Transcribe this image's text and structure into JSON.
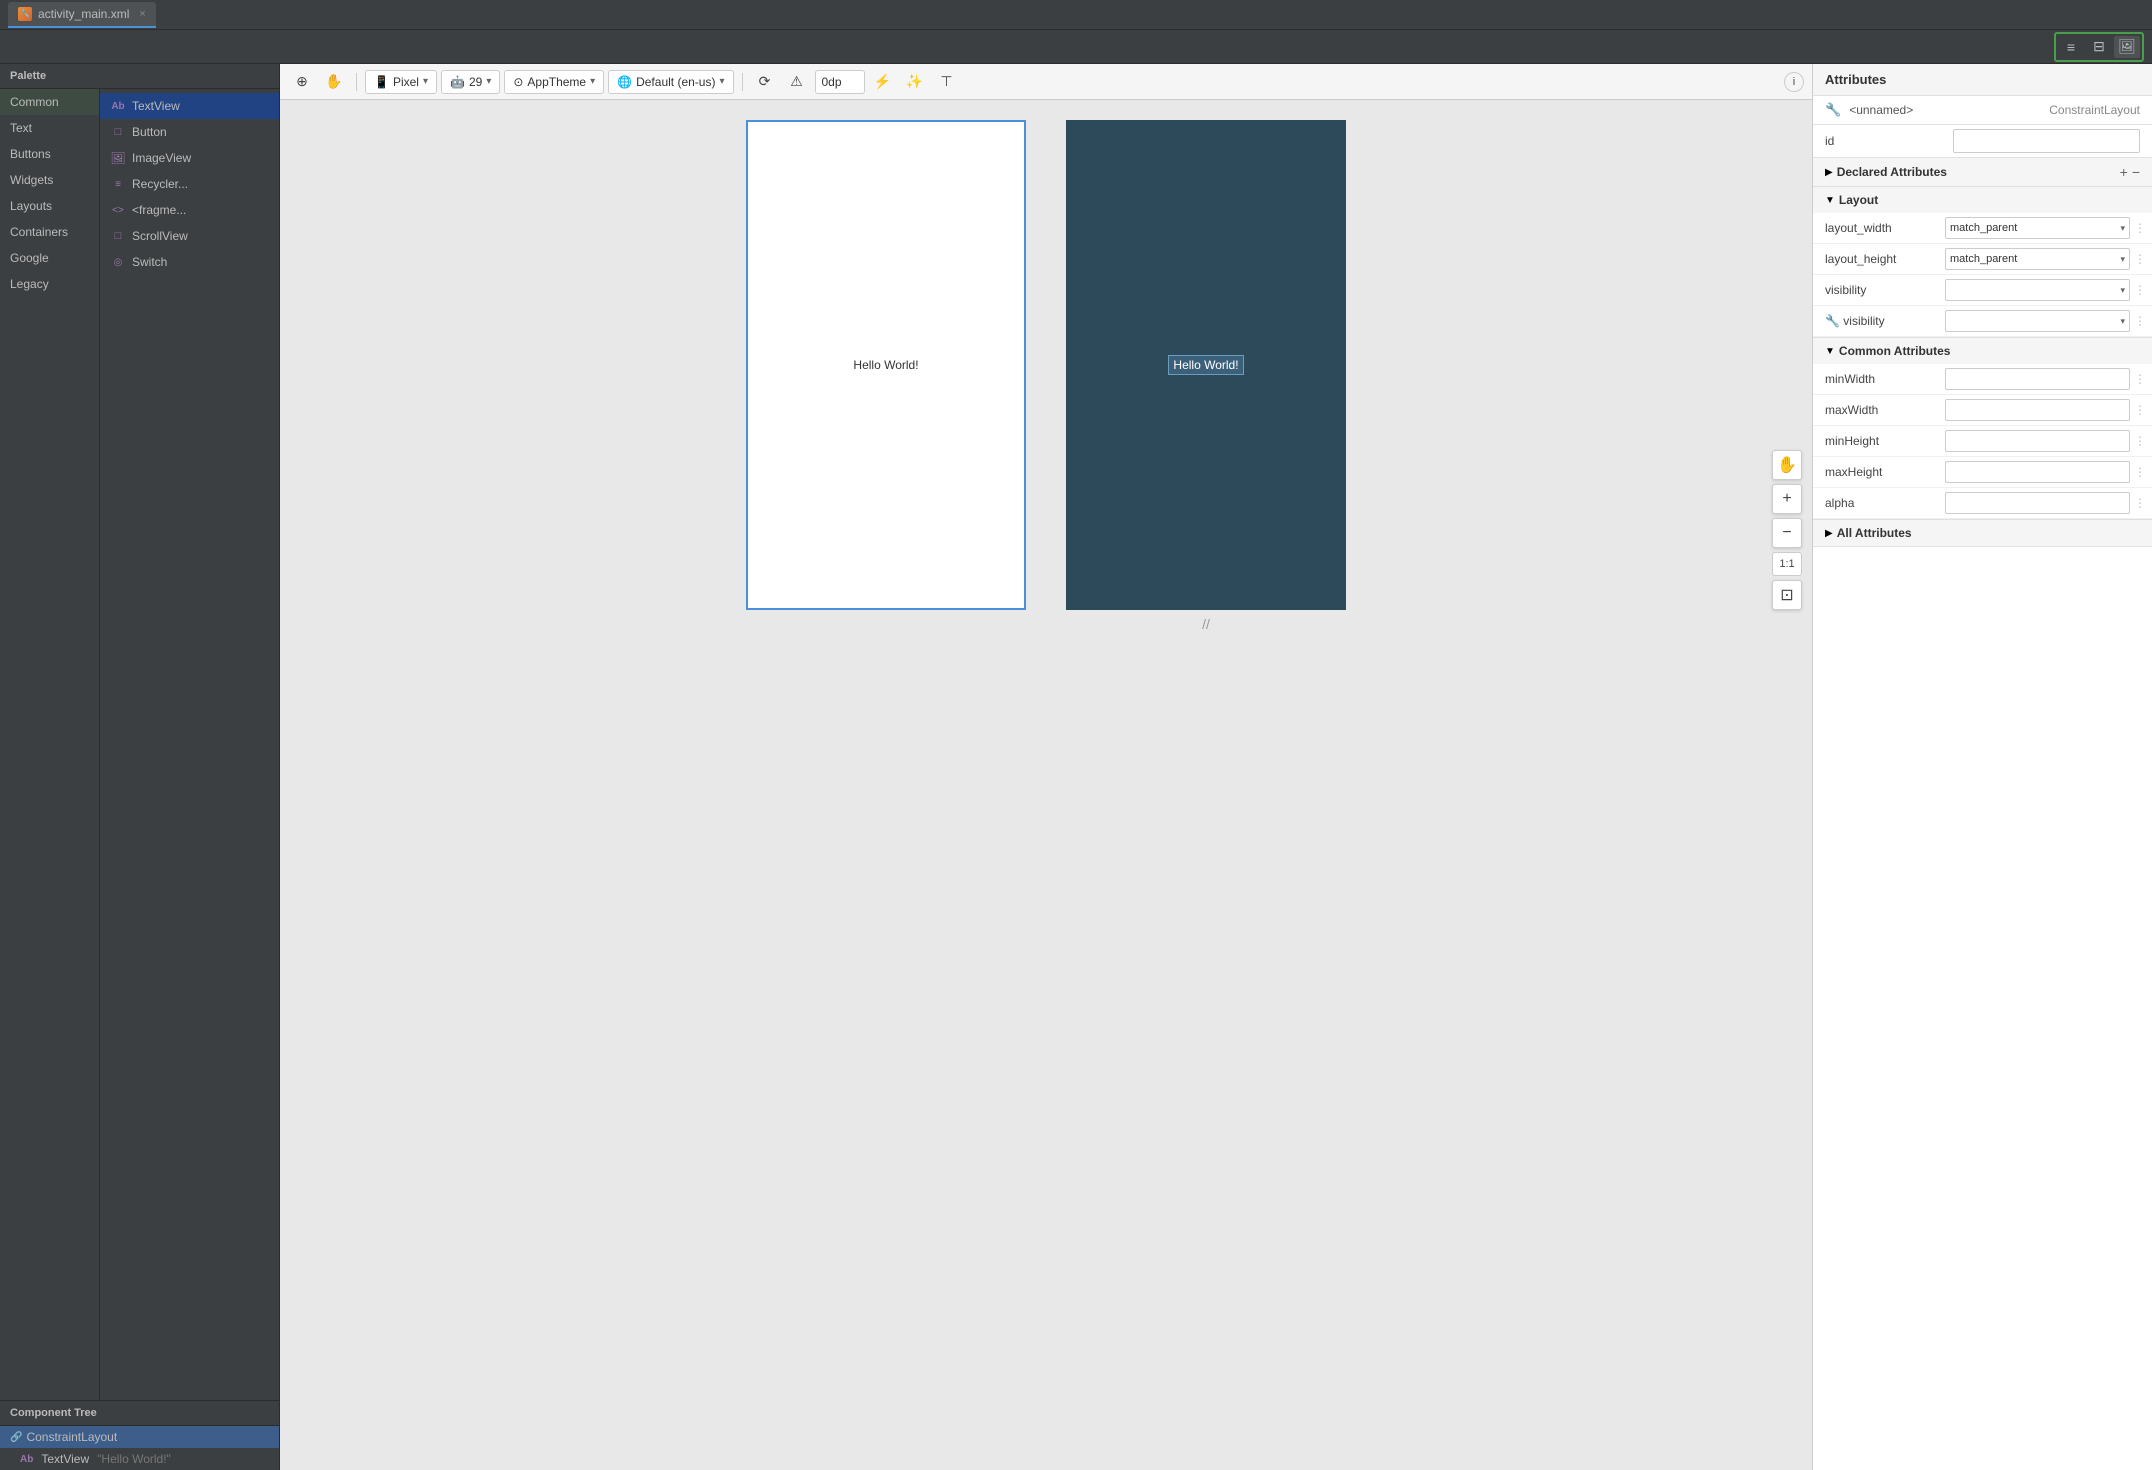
{
  "tab": {
    "icon": "🔧",
    "label": "activity_main.xml",
    "close": "×"
  },
  "toolbar_right": {
    "icons": [
      "≡",
      "⊞",
      "🖼"
    ]
  },
  "palette": {
    "header": "Palette",
    "categories": [
      {
        "id": "common",
        "label": "Common",
        "active": true
      },
      {
        "id": "text",
        "label": "Text"
      },
      {
        "id": "buttons",
        "label": "Buttons"
      },
      {
        "id": "widgets",
        "label": "Widgets"
      },
      {
        "id": "layouts",
        "label": "Layouts"
      },
      {
        "id": "containers",
        "label": "Containers"
      },
      {
        "id": "google",
        "label": "Google"
      },
      {
        "id": "legacy",
        "label": "Legacy"
      }
    ],
    "items": [
      {
        "id": "textview",
        "label": "TextView",
        "icon": "Ab",
        "selected": true
      },
      {
        "id": "button",
        "label": "Button",
        "icon": "□"
      },
      {
        "id": "imageview",
        "label": "ImageView",
        "icon": "🖼"
      },
      {
        "id": "recyclerview",
        "label": "Recycler...",
        "icon": "≡"
      },
      {
        "id": "fragment",
        "label": "<fragme...",
        "icon": "<>"
      },
      {
        "id": "scrollview",
        "label": "ScrollView",
        "icon": "□"
      },
      {
        "id": "switch",
        "label": "Switch",
        "icon": "○"
      }
    ]
  },
  "component_tree": {
    "header": "Component Tree",
    "items": [
      {
        "id": "constraint",
        "label": "ConstraintLayout",
        "icon": "🔗",
        "selected": true,
        "indent": 0
      },
      {
        "id": "textview",
        "label": "TextView",
        "suffix": "\"Hello World!\"",
        "icon": "Ab",
        "indent": 1
      }
    ]
  },
  "design_toolbar": {
    "device_label": "Pixel",
    "api_label": "29",
    "theme_label": "AppTheme",
    "locale_label": "Default (en-us)",
    "padding_value": "0dp"
  },
  "canvas": {
    "white_screen": {
      "hello_text": "Hello World!"
    },
    "dark_screen": {
      "hello_text": "Hello World!"
    }
  },
  "attributes": {
    "header": "Attributes",
    "class_name": "<unnamed>",
    "class_type": "ConstraintLayout",
    "id_label": "id",
    "sections": {
      "declared": {
        "title": "Declared Attributes",
        "collapsed": false,
        "plus": "+",
        "minus": "−"
      },
      "layout": {
        "title": "Layout",
        "collapsed": false,
        "rows": [
          {
            "label": "layout_width",
            "value": "match_parent",
            "type": "dropdown"
          },
          {
            "label": "layout_height",
            "value": "match_parent",
            "type": "dropdown"
          },
          {
            "label": "visibility",
            "value": "",
            "type": "dropdown"
          },
          {
            "label": "✱ visibility",
            "value": "",
            "type": "dropdown",
            "warning": true
          }
        ]
      },
      "common": {
        "title": "Common Attributes",
        "collapsed": false,
        "rows": [
          {
            "label": "minWidth",
            "value": "",
            "type": "input"
          },
          {
            "label": "maxWidth",
            "value": "",
            "type": "input"
          },
          {
            "label": "minHeight",
            "value": "",
            "type": "input"
          },
          {
            "label": "maxHeight",
            "value": "",
            "type": "input"
          },
          {
            "label": "alpha",
            "value": "",
            "type": "input"
          }
        ]
      },
      "all": {
        "title": "All Attributes",
        "collapsed": true
      }
    }
  },
  "zoom": {
    "plus": "+",
    "minus": "−",
    "ratio": "1:1"
  }
}
